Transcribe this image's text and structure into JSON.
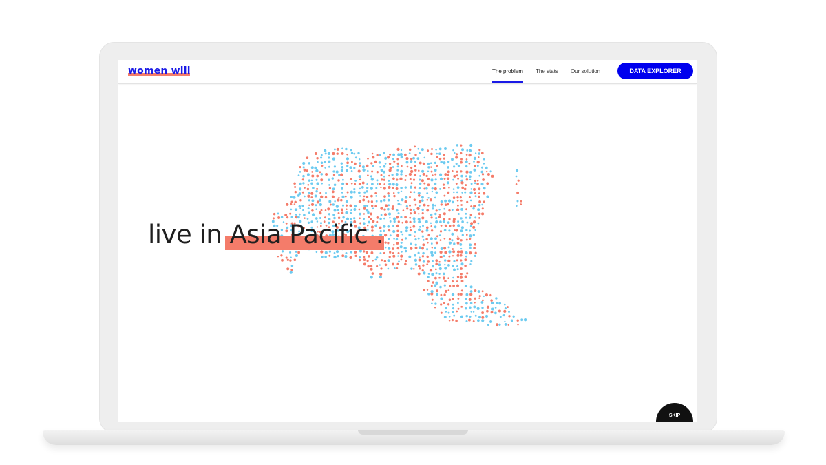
{
  "header": {
    "logo_text": "women will",
    "nav": [
      {
        "label": "The problem",
        "active": true
      },
      {
        "label": "The stats",
        "active": false
      },
      {
        "label": "Our solution",
        "active": false
      }
    ],
    "cta_label": "DATA EXPLORER"
  },
  "hero": {
    "prefix": "live in",
    "highlight": "Asia Pacific",
    "suffix": "."
  },
  "skip_label": "SKIP",
  "colors": {
    "brand_blue": "#1a1ae6",
    "cta_blue": "#0000ee",
    "coral": "#f47c6a",
    "dot_blue": "#6ecbf0",
    "dot_coral": "#f47c6a"
  },
  "map_dots": {
    "region": "Asia Pacific",
    "palette": [
      "#6ecbf0",
      "#f47c6a"
    ]
  }
}
